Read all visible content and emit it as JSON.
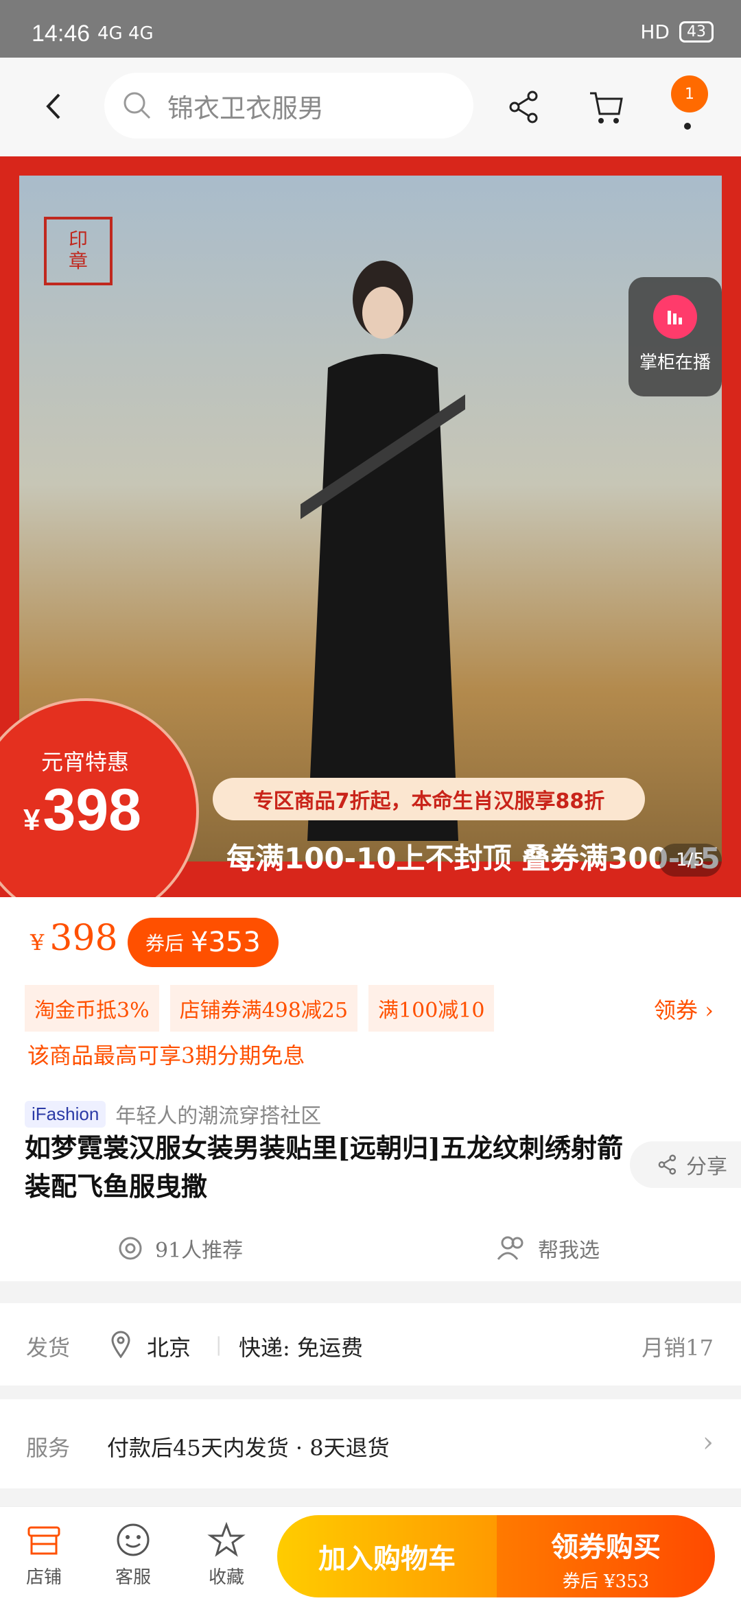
{
  "status_bar": {
    "time": "14:46",
    "signal": "4G 4G",
    "hd": "HD",
    "battery": "43"
  },
  "nav": {
    "search_placeholder": "锦衣卫衣服男",
    "message_count": "1"
  },
  "hero": {
    "live_label": "掌柜在播",
    "promo_label": "元宵特惠",
    "promo_price": "398",
    "banner_line1": "专区商品7折起，本命生肖汉服享88折",
    "banner_line2": "每满100-10上不封顶 叠券满300-45",
    "pager": "1/5"
  },
  "price": {
    "currency": "¥",
    "value": "398",
    "coupon_prefix": "券后",
    "coupon_price": "¥353"
  },
  "tags": [
    "淘金币抵3%",
    "店铺券满498减25",
    "满100减10"
  ],
  "get_coupon": "领券",
  "installment": "该商品最高可享3期分期免息",
  "ifashion": {
    "badge": "iFashion",
    "subtitle": "年轻人的潮流穿搭社区"
  },
  "title": "如梦霓裳汉服女装男装贴里[远朝归]五龙纹刺绣射箭装配飞鱼服曳撒",
  "share_label": "分享",
  "recommend": {
    "count_text": "91人推荐",
    "help_text": "帮我选"
  },
  "shipping": {
    "label": "发货",
    "location": "北京",
    "delivery": "快递: 免运费",
    "monthly_sales": "月销17"
  },
  "service": {
    "label": "服务",
    "text": "付款后45天内发货 · 8天退货"
  },
  "bottom": {
    "store": "店铺",
    "service": "客服",
    "favorite": "收藏",
    "add_cart": "加入购物车",
    "buy_main": "领券购买",
    "buy_sub": "券后 ¥353"
  },
  "colors": {
    "accent": "#ff5000",
    "banner_red": "#d8261b"
  }
}
